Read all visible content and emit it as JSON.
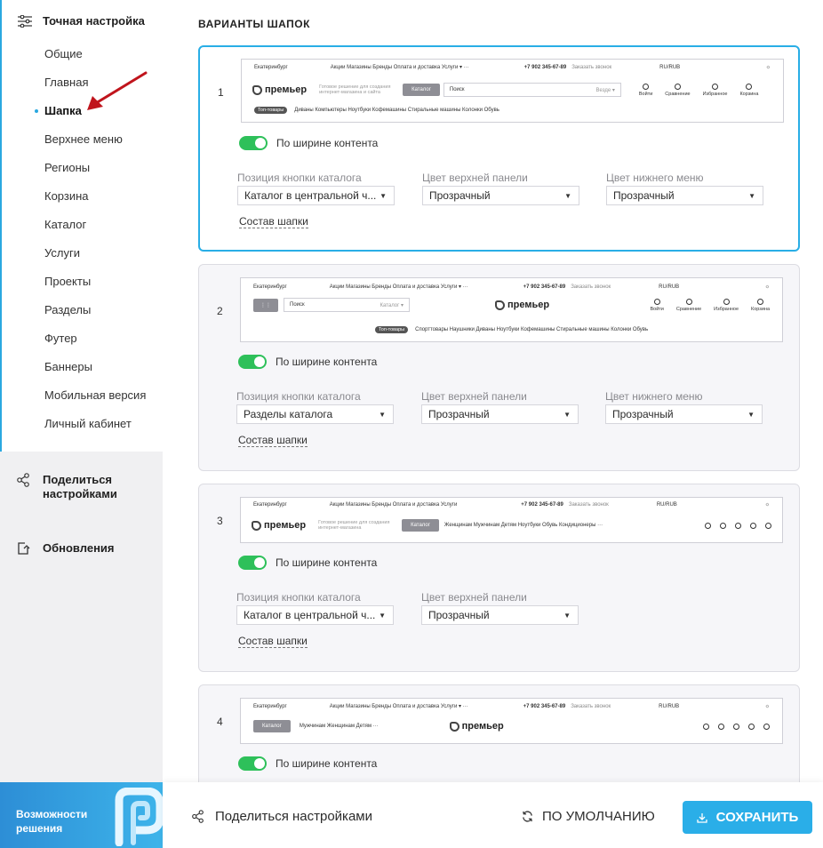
{
  "sidebar": {
    "head_label": "Точная настройка",
    "items": [
      {
        "label": "Общие"
      },
      {
        "label": "Главная"
      },
      {
        "label": "Шапка",
        "active": true
      },
      {
        "label": "Верхнее меню"
      },
      {
        "label": "Регионы"
      },
      {
        "label": "Корзина"
      },
      {
        "label": "Каталог"
      },
      {
        "label": "Услуги"
      },
      {
        "label": "Проекты"
      },
      {
        "label": "Разделы"
      },
      {
        "label": "Футер"
      },
      {
        "label": "Баннеры"
      },
      {
        "label": "Мобильная версия"
      },
      {
        "label": "Личный кабинет"
      }
    ],
    "share_label": "Поделиться настройками",
    "updates_label": "Обновления",
    "promo_label": "Возможности решения"
  },
  "main": {
    "title": "ВАРИАНТЫ ШАПОК",
    "toggle_label": "По ширине контента",
    "compose_link": "Состав шапки",
    "labels": {
      "catalog_position": "Позиция кнопки каталога",
      "top_panel_color": "Цвет верхней панели",
      "bottom_menu_color": "Цвет нижнего меню"
    },
    "cards": [
      {
        "num": "1",
        "catalog_position": "Каталог в центральной ч...",
        "top_panel_color": "Прозрачный",
        "bottom_menu_color": "Прозрачный"
      },
      {
        "num": "2",
        "catalog_position": "Разделы каталога",
        "top_panel_color": "Прозрачный",
        "bottom_menu_color": "Прозрачный"
      },
      {
        "num": "3",
        "catalog_position": "Каталог в центральной ч...",
        "top_panel_color": "Прозрачный"
      },
      {
        "num": "4"
      }
    ]
  },
  "preview": {
    "city": "Екатеринбург",
    "topnav": "Акции   Магазины   Бренды   Оплата и доставка   Услуги ▾   ···",
    "topnav_short": "Акции  Магазины  Бренды  Оплата и доставка  Услуги",
    "phone": "+7 902 345-67-89",
    "callback": "Заказать звонок",
    "currency": "RU/RUB",
    "logo": "премьер",
    "tagline": "Готовое решение для создания интернет-магазина и сайта",
    "tagline_short": "Готовое решение для создания интернет-магазина",
    "catalog_btn": "Каталог",
    "search_placeholder": "Поиск",
    "search_scope": "Везде ▾",
    "search_scope_catalog": "Каталог ▾",
    "icons": {
      "login": "Войти",
      "compare": "Сравнение",
      "fav": "Избранное",
      "cart": "Корзина"
    },
    "tag": "Топ-товары",
    "menu1": "Диваны   Компьютеры   Ноутбуки   Кофемашины   Стиральные машины   Колонки   Обувь",
    "menu2": "Спорттовары   Наушники   Диваны   Ноутбуки   Кофемашины   Стиральные машины   Колонки   Обувь",
    "menu3": "Женщинам   Мужчинам   Детям   Ноутбуки   Обувь   Кондиционеры   ···",
    "menu4": "Мужчинам   Женщинам   Детям   ···"
  },
  "bottombar": {
    "share_label": "Поделиться настройками",
    "default_label": "ПО УМОЛЧАНИЮ",
    "save_label": "СОХРАНИТЬ"
  },
  "colors": {
    "accent": "#2aaee8",
    "toggle": "#2ec05a",
    "arrow": "#c0141c"
  }
}
